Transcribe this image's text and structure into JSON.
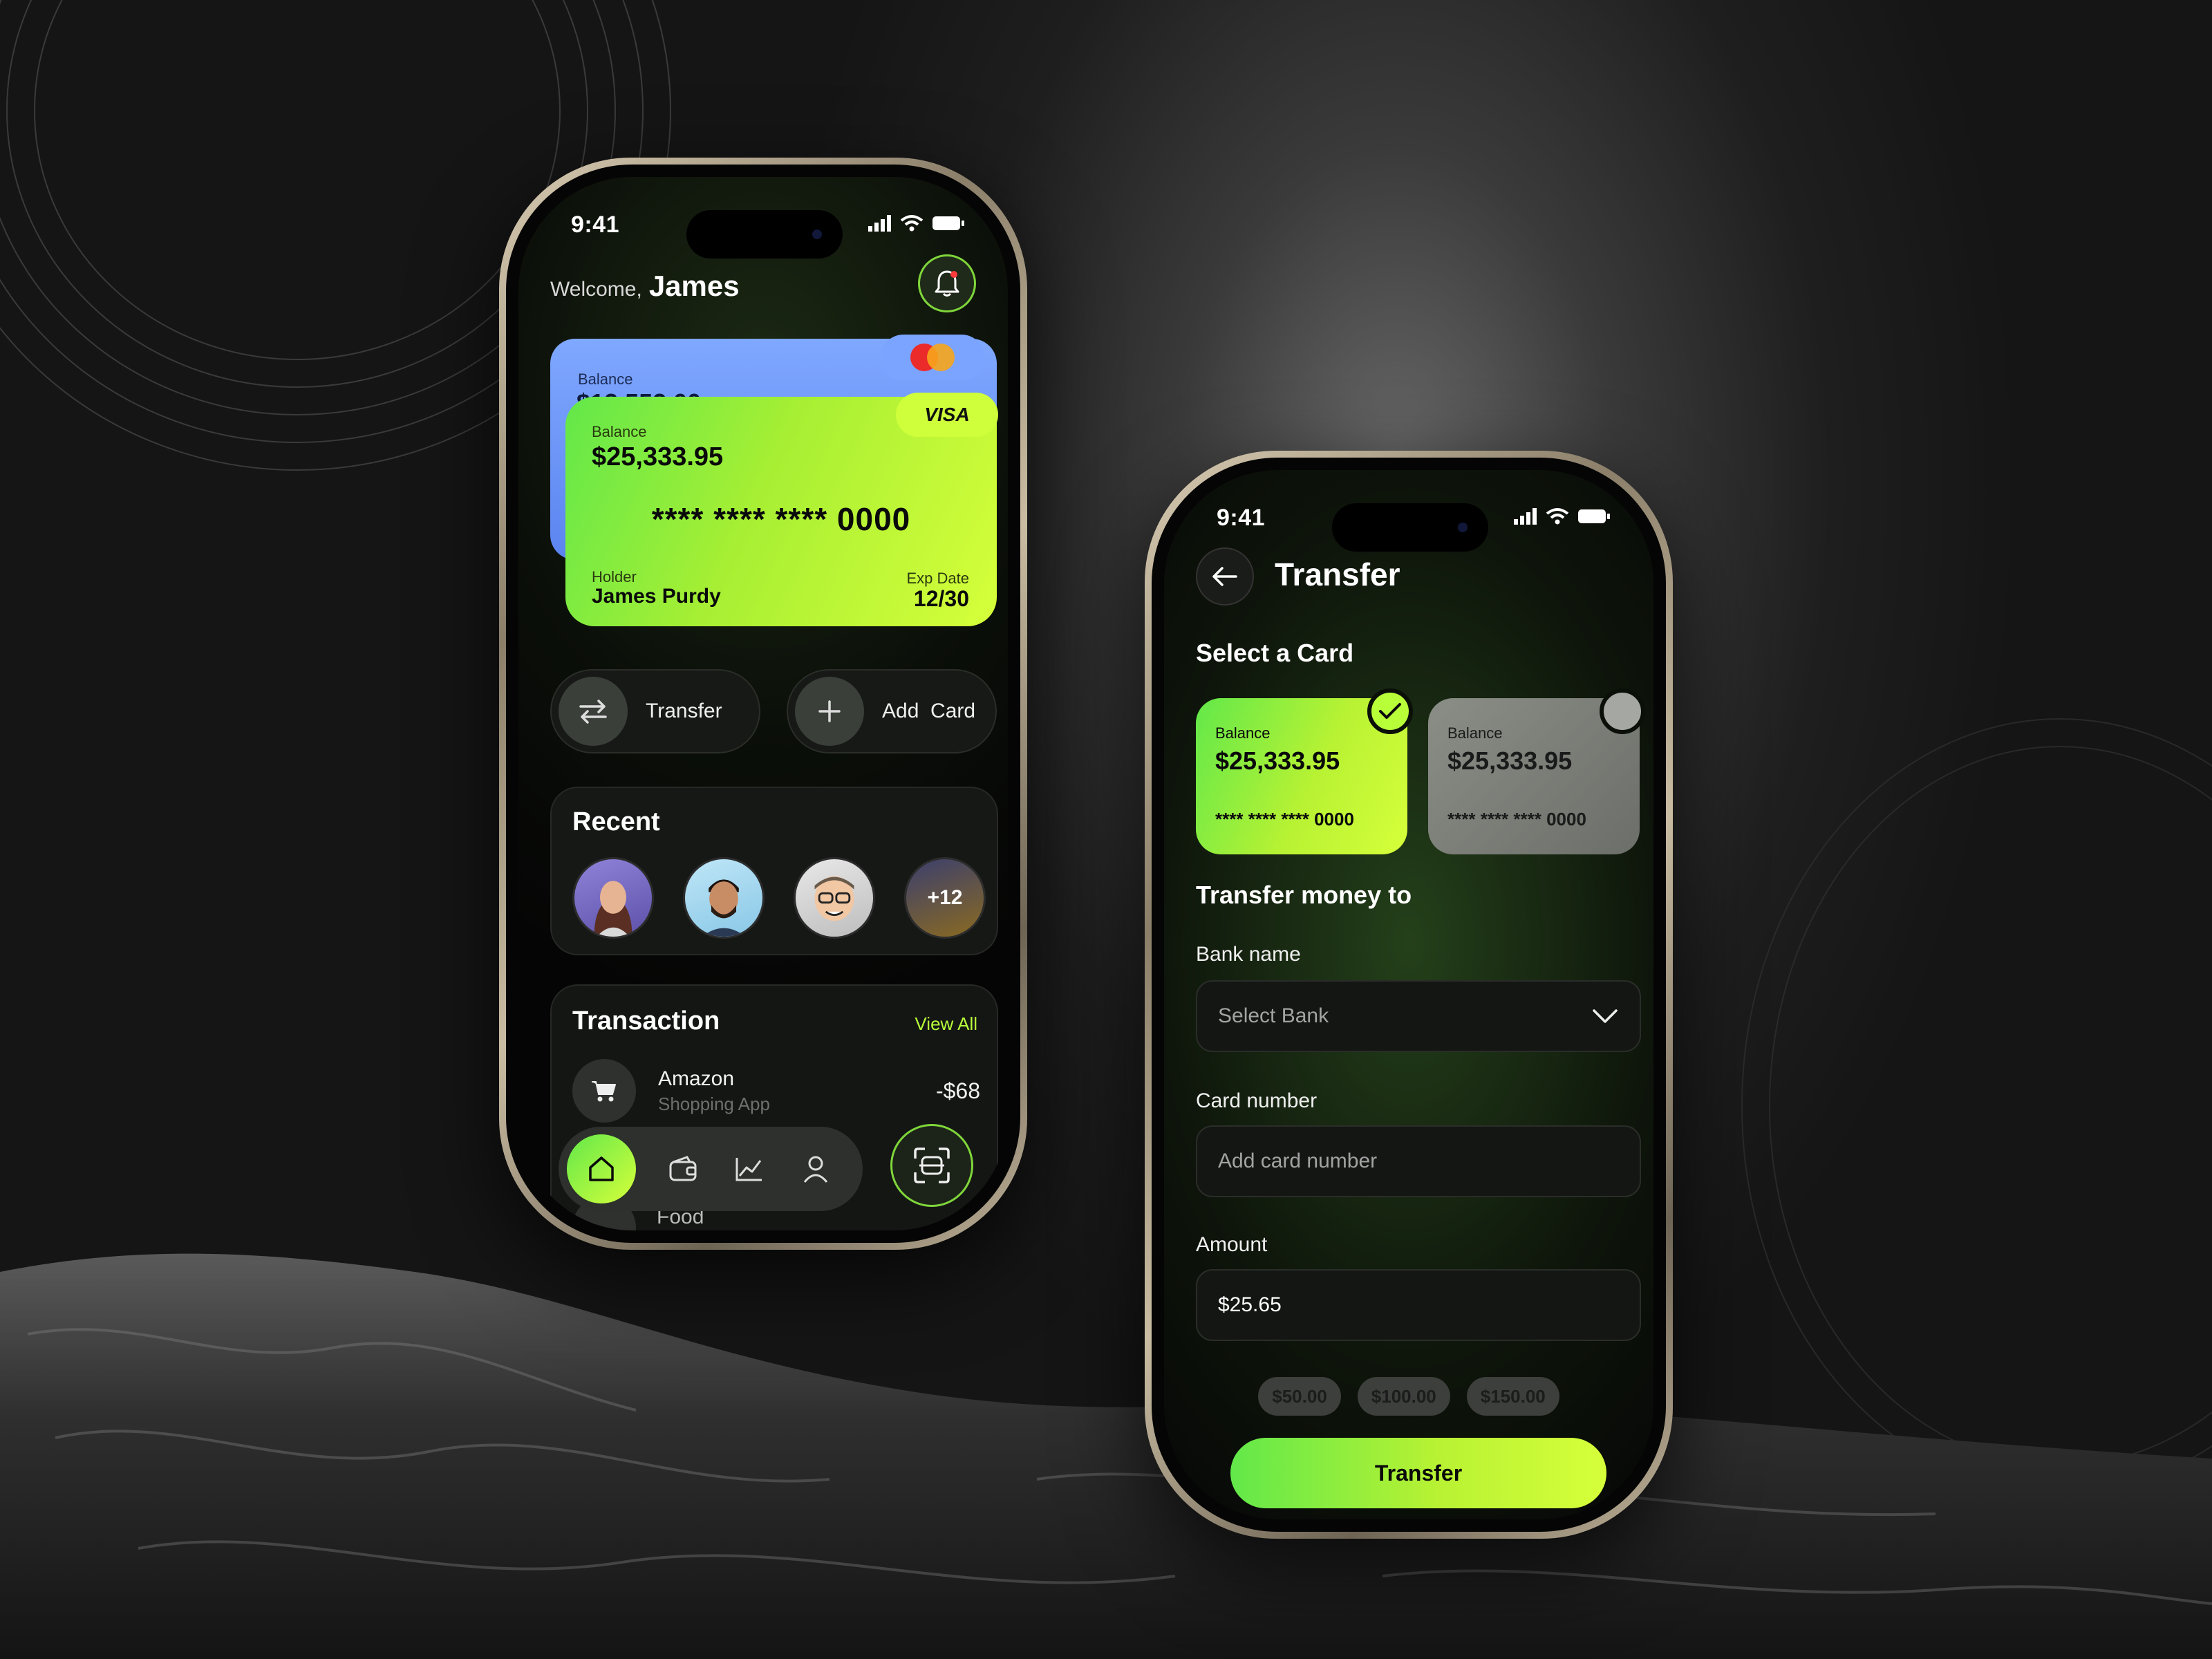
{
  "status": {
    "time": "9:41"
  },
  "home": {
    "welcome_label": "Welcome,",
    "user_name": "James",
    "back_card": {
      "label": "Balance",
      "amount": "$12,552.00"
    },
    "front_card": {
      "brand": "VISA",
      "balance_label": "Balance",
      "balance": "$25,333.95",
      "number": "**** **** **** 0000",
      "holder_label": "Holder",
      "holder": "James Purdy",
      "exp_label": "Exp Date",
      "exp": "12/30"
    },
    "actions": [
      {
        "label": "Transfer",
        "icon": "swap-arrows-icon"
      },
      {
        "label": "Add  Card",
        "icon": "plus-icon"
      }
    ],
    "recent": {
      "title": "Recent",
      "more_count": "+12"
    },
    "transactions": {
      "title": "Transaction",
      "view_all": "View All",
      "items": [
        {
          "name": "Amazon",
          "subtitle": "Shopping App",
          "amount": "-$68",
          "icon": "cart-icon"
        },
        {
          "name": "Food"
        }
      ]
    },
    "nav": [
      "home-icon",
      "wallet-icon",
      "chart-icon",
      "profile-icon"
    ]
  },
  "transfer": {
    "title": "Transfer",
    "select_card_title": "Select a Card",
    "cards": [
      {
        "label": "Balance",
        "amount": "$25,333.95",
        "number": "**** **** **** 0000",
        "selected": true
      },
      {
        "label": "Balance",
        "amount": "$25,333.95",
        "number": "**** **** **** 0000",
        "selected": false
      }
    ],
    "transfer_to_title": "Transfer money to",
    "bank_name_label": "Bank name",
    "bank_name_placeholder": "Select Bank",
    "card_number_label": "Card number",
    "card_number_placeholder": "Add card number",
    "amount_label": "Amount",
    "amount_value": "$25.65",
    "quick_amounts": [
      "$50.00",
      "$100.00",
      "$150.00"
    ],
    "submit_label": "Transfer"
  },
  "colors": {
    "accent_green": "#62e84a",
    "accent_lime": "#d6ff3a",
    "link_lime": "#b8ff3a",
    "card_blue": "#7fa8ff"
  }
}
